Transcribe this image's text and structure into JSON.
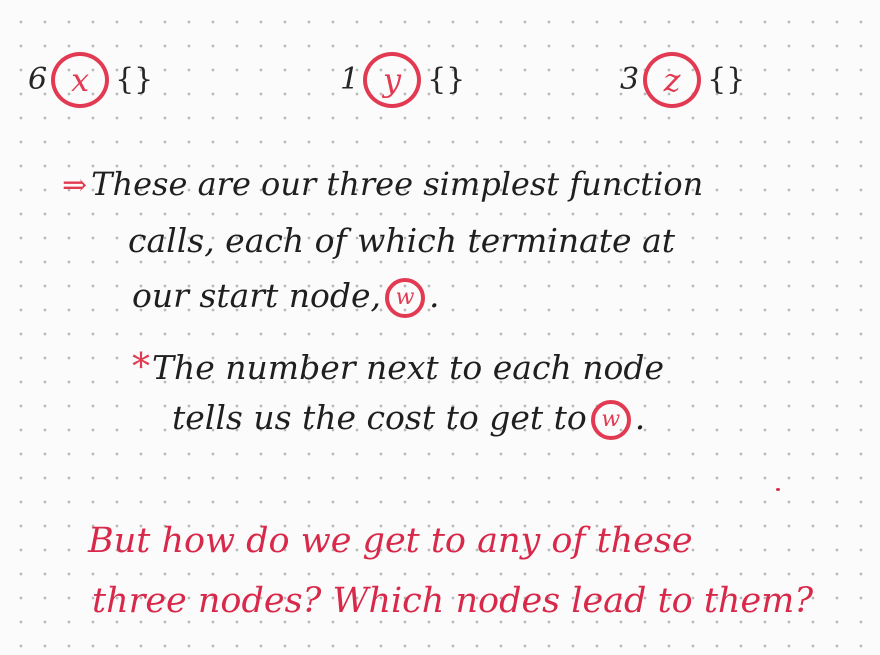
{
  "nodes": [
    {
      "cost": "6",
      "label": "x",
      "braces": "{}"
    },
    {
      "cost": "1",
      "label": "y",
      "braces": "{}"
    },
    {
      "cost": "3",
      "label": "z",
      "braces": "{}"
    }
  ],
  "note1": {
    "arrow": "⇒",
    "line1": "These are our three simplest function",
    "line2": "calls, each of which terminate at",
    "line3_before": "our start node,",
    "start_node": "w",
    "line3_after": "."
  },
  "note2": {
    "star": "*",
    "line1": "The number next to each node",
    "line2_before": "tells us the cost to get to",
    "node": "w",
    "line2_after": "."
  },
  "question": {
    "line1": "But how do we get to any of these",
    "line2": "three nodes? Which nodes lead to them?"
  },
  "colors": {
    "ink": "#1f1f1f",
    "accent_red": "#e23a52",
    "question_red": "#d8294a",
    "paper": "#fbfbfb"
  }
}
